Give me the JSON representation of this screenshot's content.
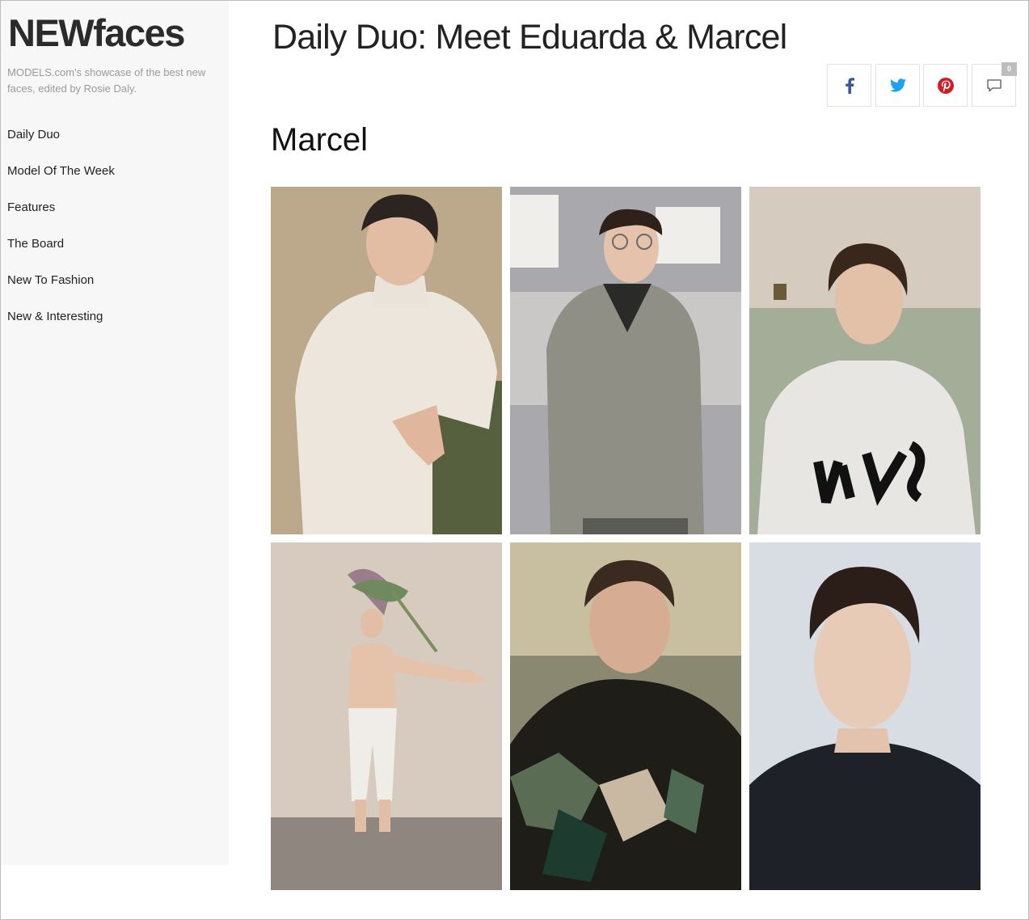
{
  "sidebar": {
    "brand": "NEWfaces",
    "tagline": "MODELS.com's showcase of the best new faces, edited by Rosie Daly.",
    "nav": [
      {
        "label": "Daily Duo"
      },
      {
        "label": "Model Of The Week"
      },
      {
        "label": "Features"
      },
      {
        "label": "The Board"
      },
      {
        "label": "New To Fashion"
      },
      {
        "label": "New & Interesting"
      }
    ]
  },
  "article": {
    "title": "Daily Duo: Meet Eduarda & Marcel",
    "section": "Marcel"
  },
  "share": {
    "facebook_icon": "facebook-icon",
    "twitter_icon": "twitter-icon",
    "pinterest_icon": "pinterest-icon",
    "comment_icon": "comment-icon",
    "comment_count": "0",
    "colors": {
      "facebook": "#3b5998",
      "twitter": "#1da1f2",
      "pinterest": "#cb2027",
      "comment": "#555555"
    }
  },
  "gallery": {
    "photos": [
      {
        "name": "marcel-photo-1"
      },
      {
        "name": "marcel-photo-2"
      },
      {
        "name": "marcel-photo-3"
      },
      {
        "name": "marcel-photo-4"
      },
      {
        "name": "marcel-photo-5"
      },
      {
        "name": "marcel-photo-6"
      }
    ]
  }
}
